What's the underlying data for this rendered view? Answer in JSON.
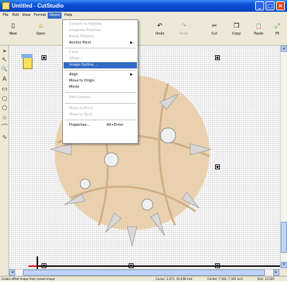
{
  "window": {
    "title": "Untitled - CutStudio",
    "buttons": [
      "_",
      "□",
      "×"
    ]
  },
  "menubar": [
    "File",
    "Edit",
    "View",
    "Format",
    "Object",
    "Help"
  ],
  "toolbar": [
    {
      "label": "New",
      "icon": "▯",
      "disabled": false
    },
    {
      "label": "Open",
      "icon": "⌂",
      "disabled": false
    },
    {
      "label": "Undo",
      "icon": "↶",
      "disabled": false
    },
    {
      "label": "Redo",
      "icon": "↷",
      "disabled": true
    },
    {
      "label": "Cut",
      "icon": "✂",
      "disabled": false
    },
    {
      "label": "Copy",
      "icon": "❐",
      "disabled": false
    },
    {
      "label": "Paste",
      "icon": "📋",
      "disabled": false
    },
    {
      "label": "Fit",
      "icon": "⤢",
      "disabled": false
    }
  ],
  "tools": [
    "➤",
    "↖",
    "🔍",
    "A",
    "▭",
    "○",
    "⬠",
    "☆",
    "⌒",
    "∿"
  ],
  "object_menu": {
    "items": [
      {
        "label": "Convert to Polyline",
        "state": "disabled"
      },
      {
        "label": "Integrate Polylines",
        "state": "disabled"
      },
      {
        "label": "Break Polyline",
        "state": "disabled"
      },
      {
        "label": "Anchor Point",
        "state": "submenu"
      },
      {
        "label": "Close",
        "state": "disabled"
      },
      {
        "label": "Offset...",
        "state": "disabled"
      },
      {
        "label": "Image Outline ...",
        "state": "highlighted"
      },
      {
        "label": "Align",
        "state": "submenu"
      },
      {
        "label": "Move to Origin",
        "state": "normal"
      },
      {
        "label": "Mirror",
        "state": "normal"
      },
      {
        "label": "Add Symbol...",
        "state": "disabled"
      },
      {
        "label": "Move to Front",
        "state": "disabled"
      },
      {
        "label": "Move to Back",
        "state": "disabled"
      },
      {
        "label": "Properties...",
        "state": "normal",
        "shortcut": "Alt+Enter"
      }
    ]
  },
  "status": {
    "hint": "Create offset shape from closed shape",
    "cursor": "Cursor: 2.371, 16.458 inch",
    "center": "Center: 7.103, 7.103 inch",
    "size": "Size: 13.505"
  },
  "colors": {
    "titlebar": "#0a4fd6",
    "highlight": "#316ac5",
    "ball": "#e8c79a"
  }
}
